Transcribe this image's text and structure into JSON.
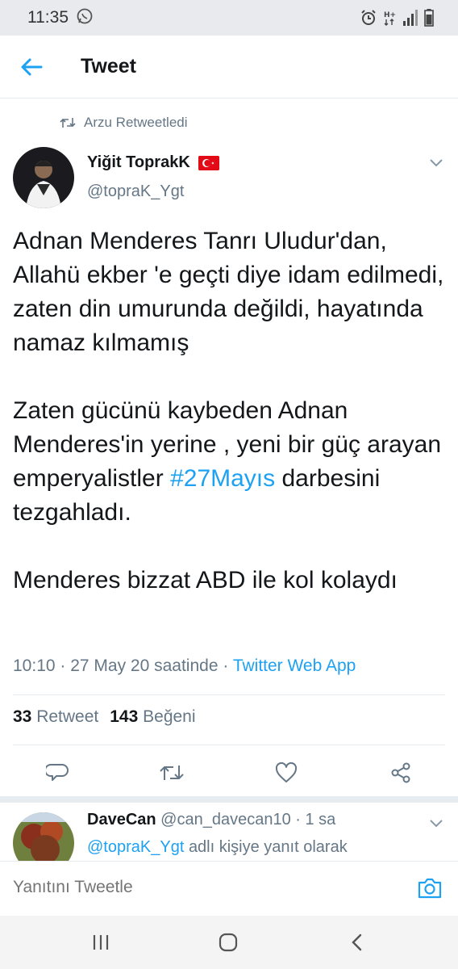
{
  "status_bar": {
    "time": "11:35"
  },
  "header": {
    "title": "Tweet"
  },
  "retweet_context": {
    "text": "Arzu Retweetledi"
  },
  "tweet": {
    "author_name": "Yiğit ToprakK",
    "author_handle": "@topraK_Ygt",
    "paragraphs": [
      "Adnan Menderes Tanrı Uludur'dan, Allahü ekber 'e geçti diye idam edilmedi, zaten din umurunda değildi, hayatında namaz kılmamış"
    ],
    "p2_before": "Zaten gücünü kaybeden Adnan Menderes'in yerine , yeni bir güç arayan emperyalistler",
    "p2_hashtag": "#27Mayıs",
    "p2_after": "darbesini tezgahladı.",
    "p3": "Menderes bizzat ABD ile kol kolaydı",
    "timestamp": "10:10 · 27 May 20 saatinde ·",
    "client": "Twitter Web App",
    "retweet_count": "33",
    "retweet_label": "Retweet",
    "like_count": "143",
    "like_label": "Beğeni"
  },
  "reply": {
    "name": "DaveCan",
    "handle": "@can_davecan10",
    "time": "· 1 sa",
    "context_mention": "@topraK_Ygt",
    "context_text": "adlı kişiye yanıt olarak"
  },
  "composer": {
    "placeholder": "Yanıtını Tweetle"
  },
  "icons": {
    "back": "arrow-left-icon",
    "retweet": "retweet-icon",
    "reply": "comment-icon",
    "like": "heart-icon",
    "share": "share-icon",
    "camera": "camera-icon"
  },
  "colors": {
    "accent": "#1da1f2",
    "muted": "#657786",
    "text": "#14171a"
  }
}
